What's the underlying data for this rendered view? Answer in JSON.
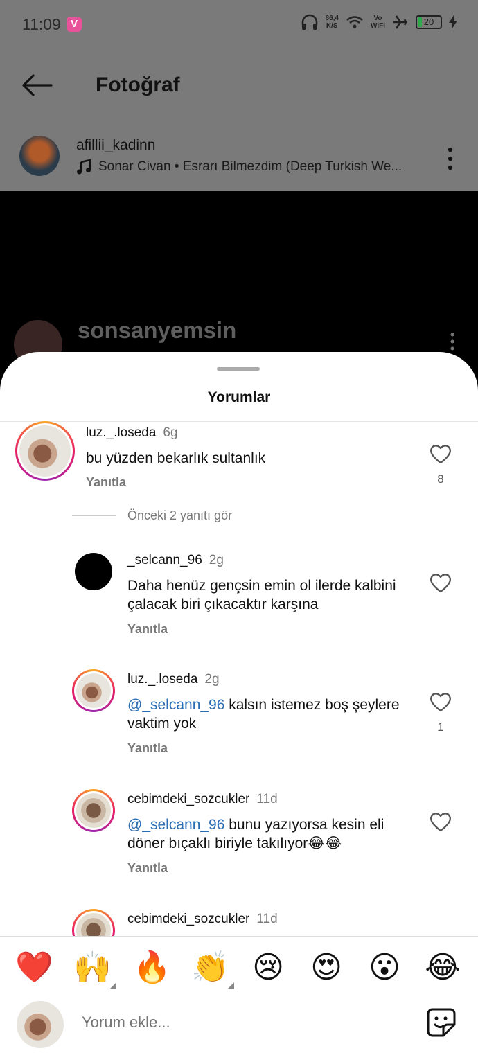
{
  "status_bar": {
    "time": "11:09",
    "speed_value": "86,4",
    "speed_unit": "K/S",
    "volte": "Vo",
    "wifi_label": "WiFi",
    "battery": "20"
  },
  "header": {
    "title": "Fotoğraf"
  },
  "post": {
    "username": "afillii_kadinn",
    "music": "Sonar Civan • Esrarı Bilmezdim (Deep Turkish We..."
  },
  "background_post": {
    "username": "sonsanyemsin"
  },
  "sheet": {
    "title": "Yorumlar"
  },
  "comments": [
    {
      "username": "luz._.loseda",
      "ago": "6g",
      "text": "bu yüzden bekarlık sultanlık",
      "reply": "Yanıtla",
      "likes": "8"
    },
    {
      "view_more": "Önceki 2 yanıtı gör"
    },
    {
      "username": "_selcann_96",
      "ago": "2g",
      "text": "Daha henüz gençsin emin ol ilerde kalbini çalacak biri çıkacaktır karşına",
      "reply": "Yanıtla"
    },
    {
      "username": "luz._.loseda",
      "ago": "2g",
      "mention": "@_selcann_96",
      "text": " kalsın istemez boş şeylere vaktim yok",
      "reply": "Yanıtla",
      "likes": "1"
    },
    {
      "username": "cebimdeki_sozcukler",
      "ago": "11d",
      "mention": "@_selcann_96",
      "text": " bunu yazıyorsa kesin eli döner bıçaklı biriyle takılıyor😂😂",
      "reply": "Yanıtla"
    },
    {
      "username": "cebimdeki_sozcukler",
      "ago": "11d"
    }
  ],
  "emoji_bar": [
    "❤️",
    "🙌",
    "🔥",
    "👏",
    "😢",
    "😍",
    "😮",
    "😂"
  ],
  "composer": {
    "placeholder": "Yorum ekle..."
  }
}
